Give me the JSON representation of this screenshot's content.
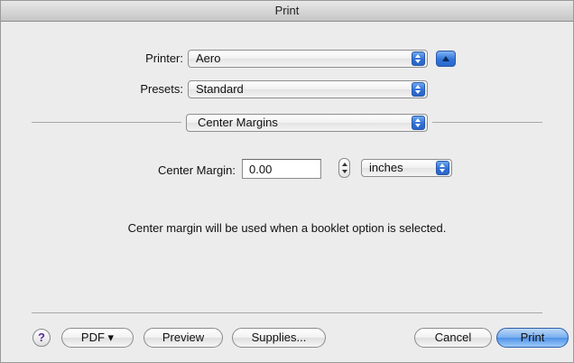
{
  "window": {
    "title": "Print"
  },
  "printer": {
    "label": "Printer:",
    "value": "Aero"
  },
  "presets": {
    "label": "Presets:",
    "value": "Standard"
  },
  "section": {
    "value": "Center Margins"
  },
  "center_margin": {
    "label": "Center Margin:",
    "value": "0.00",
    "units": "inches"
  },
  "info": {
    "text": "Center margin will be used when a booklet option is selected."
  },
  "footer": {
    "help_label": "?",
    "pdf_label": "PDF ▾",
    "preview_label": "Preview",
    "supplies_label": "Supplies...",
    "cancel_label": "Cancel",
    "print_label": "Print"
  },
  "icons": {
    "popup": "up-down-arrows-icon",
    "expand": "disclosure-up-triangle-icon",
    "stepper": "stepper-arrows-icon",
    "help": "help-icon"
  },
  "colors": {
    "accent": "#3174da",
    "default_button": "#78aef0",
    "help_glyph": "#5a2aa0"
  }
}
